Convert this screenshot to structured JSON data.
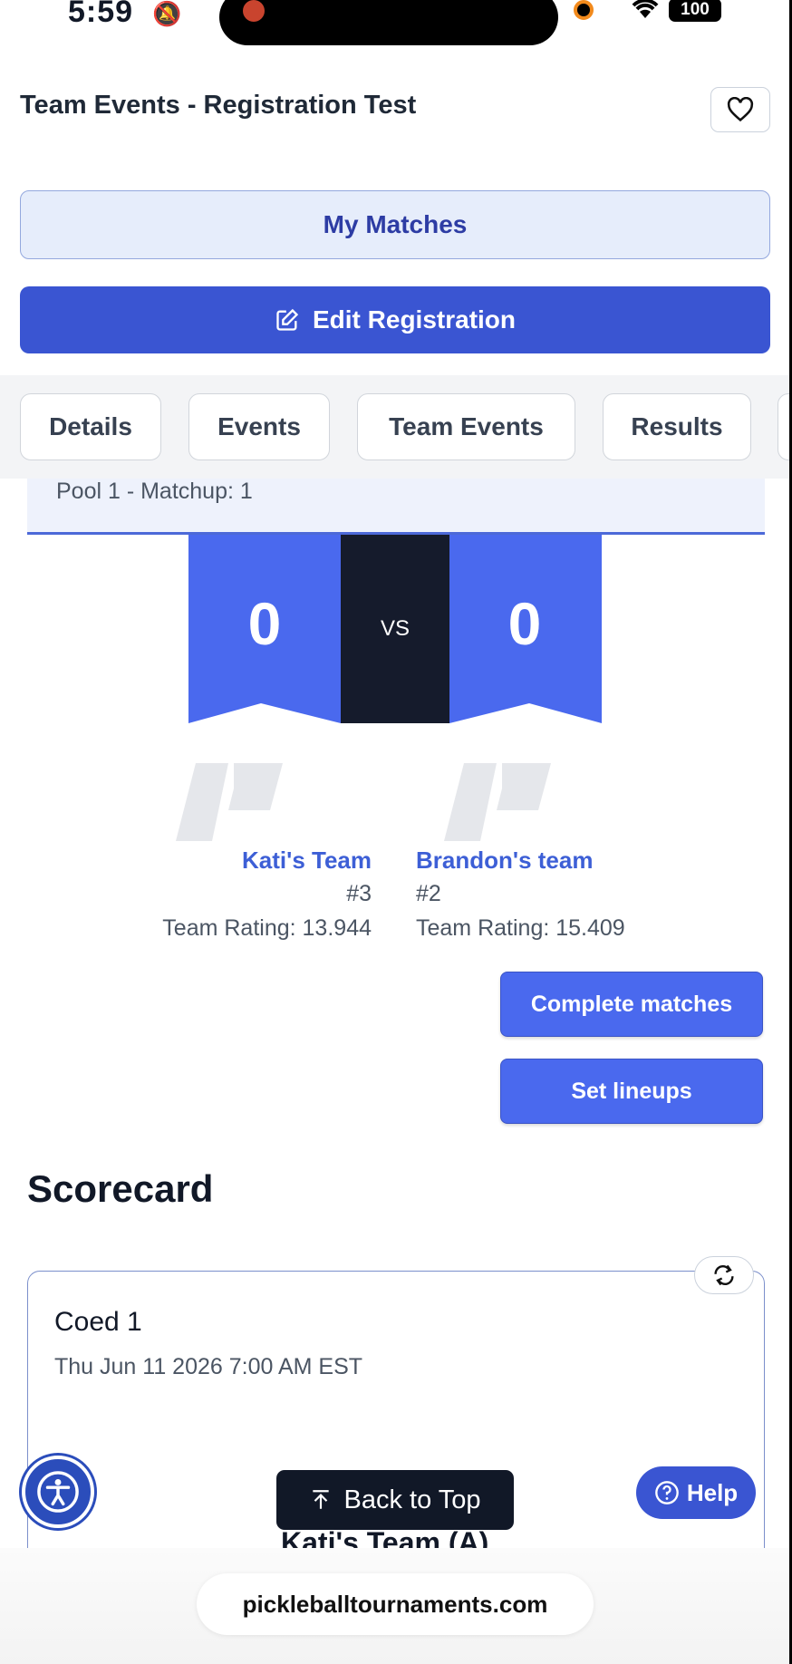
{
  "status_bar": {
    "time": "5:59",
    "battery": "100"
  },
  "header": {
    "title": "Team Events - Registration Test"
  },
  "buttons": {
    "my_matches": "My Matches",
    "edit_registration": "Edit Registration"
  },
  "tabs": [
    {
      "label": "Details"
    },
    {
      "label": "Events"
    },
    {
      "label": "Team Events"
    },
    {
      "label": "Results"
    }
  ],
  "matchup": {
    "label": "Pool 1 - Matchup: 1",
    "vs": "VS",
    "team_a": {
      "name": "Kati's Team",
      "seed": "#3",
      "rating": "Team Rating: 13.944",
      "score": "0"
    },
    "team_b": {
      "name": "Brandon's team",
      "seed": "#2",
      "rating": "Team Rating: 15.409",
      "score": "0"
    }
  },
  "actions": {
    "complete": "Complete matches",
    "lineups": "Set lineups"
  },
  "scorecard": {
    "title": "Scorecard",
    "card_title": "Coed 1",
    "card_date": "Thu Jun 11 2026 7:00 AM EST",
    "card_team": "Kati's Team (A)"
  },
  "floating": {
    "back_to_top": "Back to Top",
    "help": "Help"
  },
  "browser": {
    "url": "pickleballtournaments.com"
  },
  "colors": {
    "primary": "#3a55d2",
    "score_blue": "#4a69ee",
    "dark": "#111827"
  }
}
